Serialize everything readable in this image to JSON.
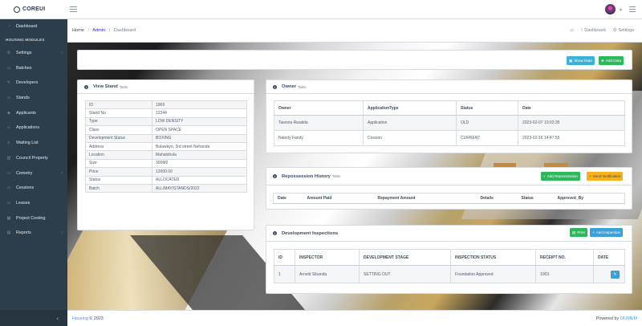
{
  "header": {
    "brand": "COREUI"
  },
  "sidebar": {
    "items": [
      {
        "label": "Dashboard",
        "icon": "speedometer-icon"
      },
      {
        "label": "HOUSING MODULES",
        "type": "title"
      },
      {
        "label": "Settings",
        "icon": "settings-icon",
        "chevron": true
      },
      {
        "label": "Batches",
        "icon": "layers-icon"
      },
      {
        "label": "Developers",
        "icon": "pencil-icon"
      },
      {
        "label": "Stands",
        "icon": "folder-icon"
      },
      {
        "label": "Applicants",
        "icon": "people-icon"
      },
      {
        "label": "Applications",
        "icon": "folder-icon"
      },
      {
        "label": "Waiting List",
        "icon": "list-icon"
      },
      {
        "label": "Council Property",
        "icon": "building-icon"
      },
      {
        "label": "Cemetry",
        "icon": "folder-icon",
        "chevron": true
      },
      {
        "label": "Cessions",
        "icon": "folder-icon"
      },
      {
        "label": "Leases",
        "icon": "folder-icon"
      },
      {
        "label": "Project Costing",
        "icon": "calculator-icon"
      },
      {
        "label": "Reports",
        "icon": "chart-icon",
        "chevron": true
      }
    ]
  },
  "breadcrumb": {
    "home": "Home",
    "admin": "Admin",
    "current": "Dashboard"
  },
  "subheader_actions": {
    "dashboard": "Dashboard",
    "settings": "Settings"
  },
  "top_card": {
    "show_data": "Show Data",
    "add_data": "Add Data"
  },
  "view_stand": {
    "title": "View Stand",
    "subtitle": "Table",
    "rows": [
      [
        "ID",
        "1969"
      ],
      [
        "Stand No",
        "12344"
      ],
      [
        "Type",
        "LOW DENSITY"
      ],
      [
        "Class",
        "OPEN SPACE"
      ],
      [
        "Development Status",
        "BOXING"
      ],
      [
        "Address",
        "Bulawayo, 3rd street Nehanda"
      ],
      [
        "Location",
        "Mahatshula"
      ],
      [
        "Size",
        "300M2"
      ],
      [
        "Price",
        "12000.00"
      ],
      [
        "Status",
        "ALLOCATED"
      ],
      [
        "Batch",
        "ALL/MAY/STANDS/2022"
      ]
    ]
  },
  "owner": {
    "title": "Owner",
    "subtitle": "Table",
    "columns": [
      "Owner",
      "ApplicationType",
      "Status",
      "Date"
    ],
    "rows": [
      [
        "Tawona Rwatida",
        "Application",
        "OLD",
        "2023-02-07 10:02:35"
      ],
      [
        "Naledy Fandy",
        "Cession",
        "CURRENT",
        "2023-02-16 14:47:55"
      ]
    ]
  },
  "repossession": {
    "title": "Repossession History",
    "subtitle": "Table",
    "add_label": "Add Repossession",
    "notify_label": "Send Notification",
    "columns": [
      "Date",
      "Amount Paid",
      "Repayment Amount",
      "Details",
      "Status",
      "Approved_By"
    ]
  },
  "inspections": {
    "title": "Development Inspections",
    "print_label": "Print",
    "add_label": "Add Inspection",
    "columns": [
      "ID",
      "INSPECTOR",
      "DEVELOPMENT STAGE",
      "INSPECTION STATUS",
      "RECEIPT NO.",
      "DATE"
    ],
    "rows": [
      [
        "1",
        "Arnold Sibanda",
        "SETTING OUT",
        "Foundation Approved",
        "1003",
        ""
      ]
    ]
  },
  "footer": {
    "left_link": "Housing",
    "left_text": "© 2023",
    "right_text": "Powered by",
    "right_link": "OLIMEM"
  },
  "colors": {
    "sidebar": "#2c3e4b",
    "info": "#39b2d9",
    "success": "#2eb85c",
    "warning": "#f9b115",
    "primary": "#39a0d9"
  }
}
